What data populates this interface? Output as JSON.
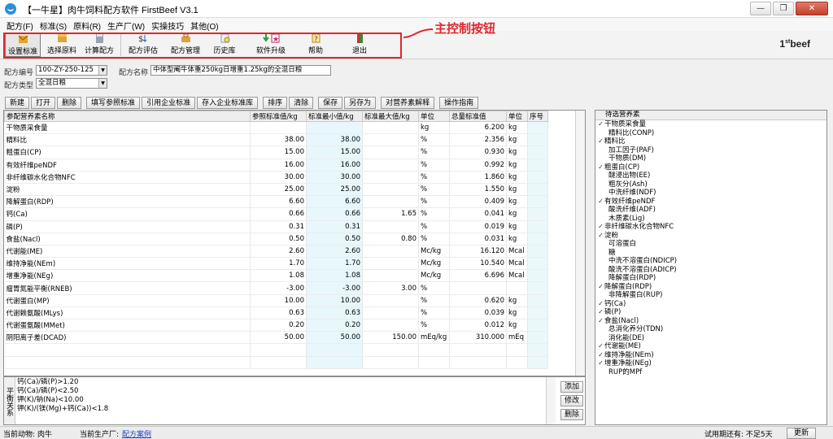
{
  "window": {
    "title": "【一牛星】肉牛饲料配方软件 FirstBeef V3.1",
    "controls": [
      "—",
      "❐",
      "✕"
    ]
  },
  "menu": [
    "配方(F)",
    "标准(S)",
    "原料(R)",
    "生产厂(W)",
    "实操技巧",
    "其他(O)"
  ],
  "toolbar": {
    "buttons": [
      "设置标准",
      "选择原料",
      "计算配方",
      "配方评估",
      "配方管理",
      "历史库",
      "软件升级",
      "帮助",
      "退出"
    ],
    "brand_prefix": "1",
    "brand_sup": "st",
    "brand_text": "beef"
  },
  "annotation": {
    "label": "主控制按钮",
    "color": "#e0262b"
  },
  "form": {
    "code_label": "配方编号",
    "code_value": "100-ZY-250-125",
    "name_label": "配方名称",
    "name_value": "中体型阉牛体重250kg日增重1.25kg的全混日粮",
    "type_label": "配方类型",
    "type_value": "全混日粮"
  },
  "actions": [
    "新建",
    "打开",
    "删除",
    "填写参照标准",
    "引用企业标准",
    "存入企业标准库",
    "排序",
    "清除",
    "保存",
    "另存为",
    "对营养素解释",
    "操作指南"
  ],
  "grid": {
    "headers": [
      "参配营养素名称",
      "参照标准值/kg",
      "标准最小值/kg",
      "标准最大值/kg",
      "单位",
      "总量标准值",
      "单位",
      "序号"
    ],
    "rows": [
      [
        "干物质采食量",
        "",
        "",
        "",
        "kg",
        "6.200",
        "kg",
        ""
      ],
      [
        "精料比",
        "38.00",
        "38.00",
        "",
        "%",
        "2.356",
        "kg",
        ""
      ],
      [
        "粗蛋白(CP)",
        "15.00",
        "15.00",
        "",
        "%",
        "0.930",
        "kg",
        ""
      ],
      [
        "有效纤维peNDF",
        "16.00",
        "16.00",
        "",
        "%",
        "0.992",
        "kg",
        ""
      ],
      [
        "非纤维碳水化合物NFC",
        "30.00",
        "30.00",
        "",
        "%",
        "1.860",
        "kg",
        ""
      ],
      [
        "淀粉",
        "25.00",
        "25.00",
        "",
        "%",
        "1.550",
        "kg",
        ""
      ],
      [
        "降解蛋白(RDP)",
        "6.60",
        "6.60",
        "",
        "%",
        "0.409",
        "kg",
        ""
      ],
      [
        "钙(Ca)",
        "0.66",
        "0.66",
        "1.65",
        "%",
        "0.041",
        "kg",
        ""
      ],
      [
        "磷(P)",
        "0.31",
        "0.31",
        "",
        "%",
        "0.019",
        "kg",
        ""
      ],
      [
        "食盐(Nacl)",
        "0.50",
        "0.50",
        "0.80",
        "%",
        "0.031",
        "kg",
        ""
      ],
      [
        "代谢能(ME)",
        "2.60",
        "2.60",
        "",
        "Mc/kg",
        "16.120",
        "Mcal",
        ""
      ],
      [
        "维持净能(NEm)",
        "1.70",
        "1.70",
        "",
        "Mc/kg",
        "10.540",
        "Mcal",
        ""
      ],
      [
        "增重净能(NEg)",
        "1.08",
        "1.08",
        "",
        "Mc/kg",
        "6.696",
        "Mcal",
        ""
      ],
      [
        "瘤胃氮能平衡(RNEB)",
        "-3.00",
        "-3.00",
        "3.00",
        "%",
        "",
        "",
        ""
      ],
      [
        "代谢蛋白(MP)",
        "10.00",
        "10.00",
        "",
        "%",
        "0.620",
        "kg",
        ""
      ],
      [
        "代谢赖氨酸(MLys)",
        "0.63",
        "0.63",
        "",
        "%",
        "0.039",
        "kg",
        ""
      ],
      [
        "代谢蛋氨酸(MMet)",
        "0.20",
        "0.20",
        "",
        "%",
        "0.012",
        "kg",
        ""
      ],
      [
        "阴阳离子差(DCAD)",
        "50.00",
        "50.00",
        "150.00",
        "mEq/kg",
        "310.000",
        "mEq",
        ""
      ]
    ]
  },
  "balance": {
    "vertical_label": "平衡关系",
    "rules": [
      "钙(Ca)/磷(P)>1.20",
      "钙(Ca)/磷(P)<2.50",
      "钾(K)/钠(Na)<10.00",
      "钾(K)/(镁(Mg)+钙(Ca))<1.8"
    ],
    "buttons": [
      "添加",
      "修改",
      "删除"
    ]
  },
  "candidates": {
    "header": "待选营养素",
    "items": [
      {
        "label": "干物质采食量",
        "check": true
      },
      {
        "label": "精料比(CONP)",
        "check": false
      },
      {
        "label": "精料比",
        "check": true
      },
      {
        "label": "加工因子(PAF)",
        "check": false
      },
      {
        "label": "干物质(DM)",
        "check": false
      },
      {
        "label": "粗蛋白(CP)",
        "check": true
      },
      {
        "label": "醚浸出物(EE)",
        "check": false
      },
      {
        "label": "粗灰分(Ash)",
        "check": false
      },
      {
        "label": "中洗纤维(NDF)",
        "check": false
      },
      {
        "label": "有效纤维peNDF",
        "check": true
      },
      {
        "label": "酸洗纤维(ADF)",
        "check": false
      },
      {
        "label": "木质素(Lig)",
        "check": false
      },
      {
        "label": "非纤维碳水化合物NFC",
        "check": true
      },
      {
        "label": "淀粉",
        "check": true
      },
      {
        "label": "可溶蛋白",
        "check": false
      },
      {
        "label": "糖",
        "check": false
      },
      {
        "label": "中洗不溶蛋白(NDICP)",
        "check": false
      },
      {
        "label": "酸洗不溶蛋白(ADICP)",
        "check": false
      },
      {
        "label": "降解蛋白(RDP)",
        "check": false
      },
      {
        "label": "降解蛋白(RDP)",
        "check": true
      },
      {
        "label": "非降解蛋白(RUP)",
        "check": false
      },
      {
        "label": "钙(Ca)",
        "check": true
      },
      {
        "label": "磷(P)",
        "check": true
      },
      {
        "label": "食盐(Nacl)",
        "check": true
      },
      {
        "label": "总消化养分(TDN)",
        "check": false
      },
      {
        "label": "消化能(DE)",
        "check": false
      },
      {
        "label": "代谢能(ME)",
        "check": true
      },
      {
        "label": "维持净能(NEm)",
        "check": true
      },
      {
        "label": "增重净能(NEg)",
        "check": true
      },
      {
        "label": "RUP的MPf",
        "check": false
      }
    ]
  },
  "status": {
    "animal_label": "当前动物:",
    "animal": "肉牛",
    "factory_label": "当前生产厂:",
    "factory": "配方案例",
    "trial": "试用期还有: 不足5天",
    "renew": "更新"
  }
}
